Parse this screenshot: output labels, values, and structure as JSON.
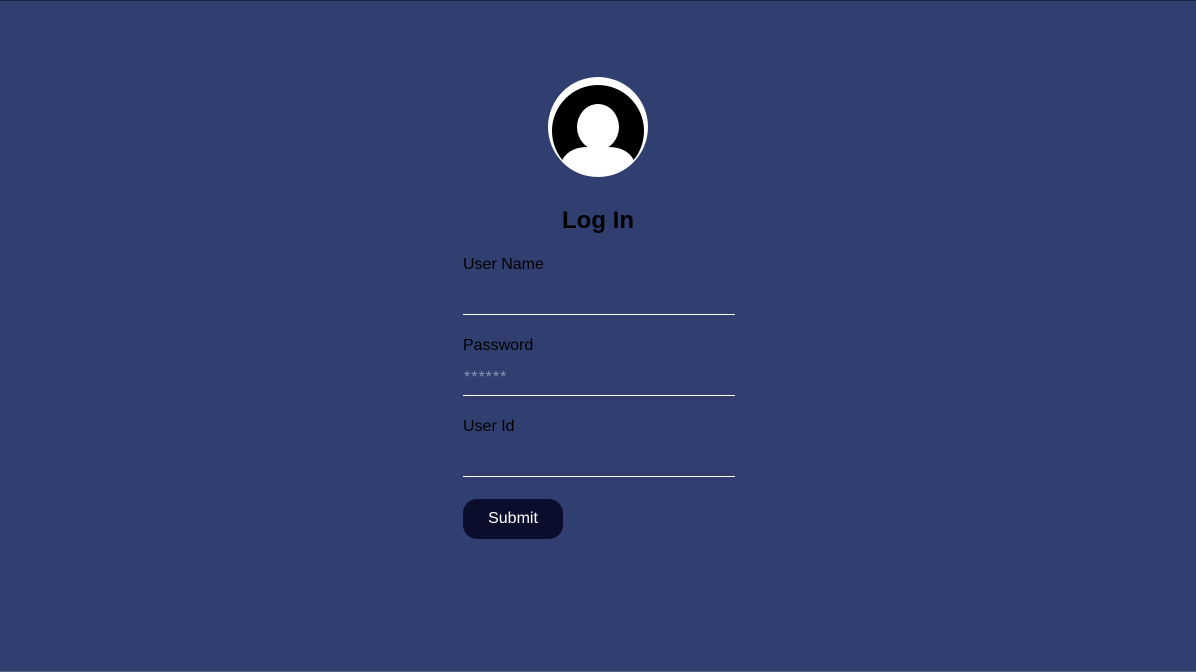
{
  "login": {
    "title": "Log In",
    "fields": [
      {
        "label": "User Name",
        "value": "",
        "placeholder": ""
      },
      {
        "label": "Password",
        "value": "",
        "placeholder": "******"
      },
      {
        "label": "User Id",
        "value": "",
        "placeholder": ""
      }
    ],
    "submit_label": "Submit"
  },
  "icons": {
    "avatar": "user-avatar-icon"
  },
  "colors": {
    "background": "#313e70",
    "button": "#0a0d2c",
    "underline": "#ffffff"
  }
}
